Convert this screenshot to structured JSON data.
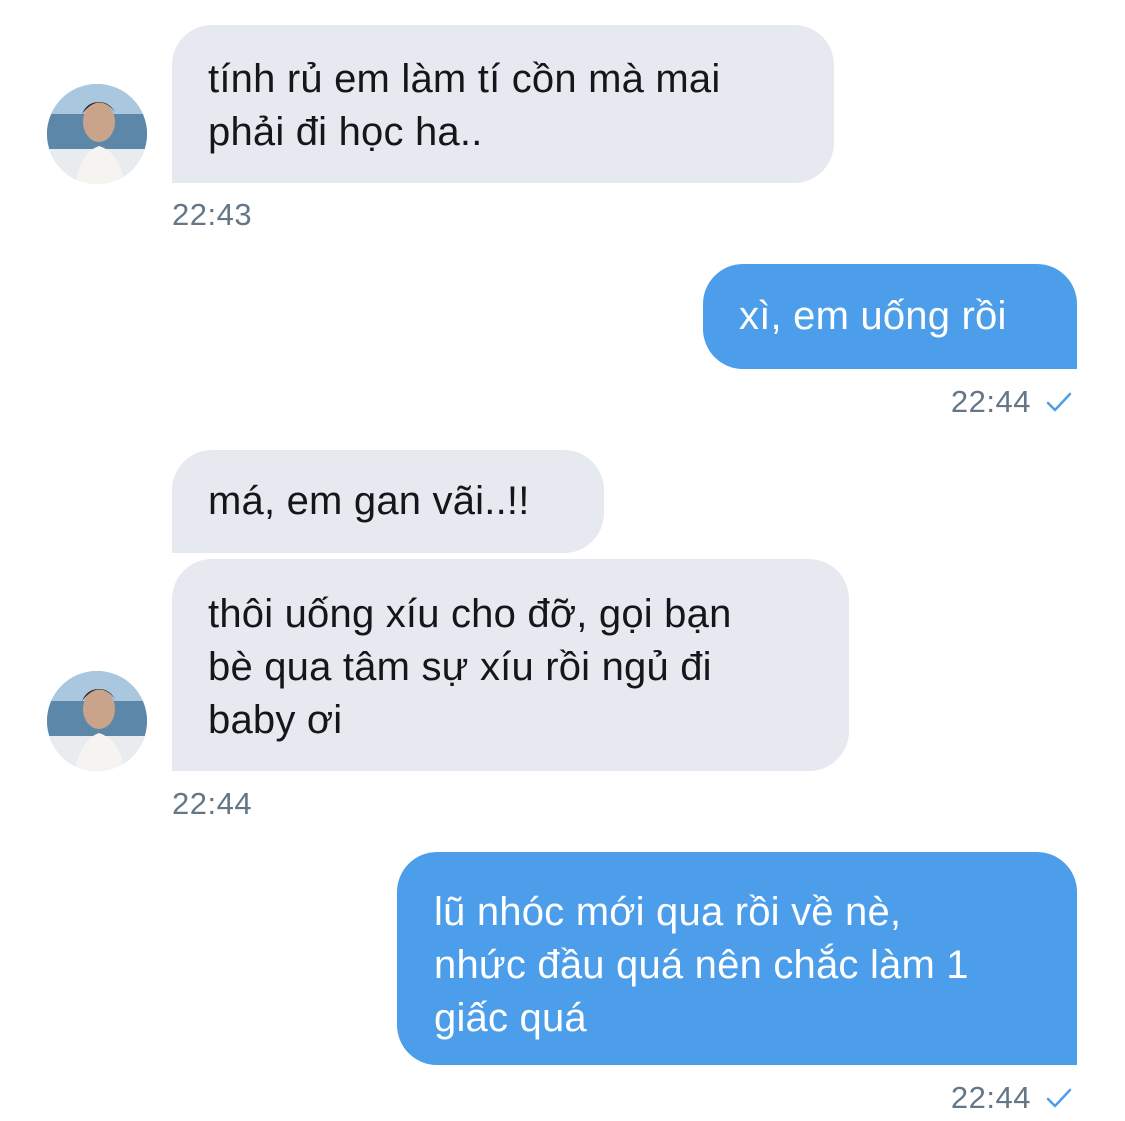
{
  "messages": [
    {
      "sender": "them",
      "text": "tính rủ em làm tí cồn mà mai\nphải đi học ha..",
      "time": "22:43"
    },
    {
      "sender": "me",
      "text": "xì, em uống rồi",
      "time": "22:44",
      "status": "sent-check"
    },
    {
      "sender": "them",
      "text": "má, em gan vãi..!!"
    },
    {
      "sender": "them",
      "text": "thôi uống xíu cho đỡ, gọi bạn\nbè qua tâm sự xíu rồi ngủ đi\nbaby ơi",
      "time": "22:44"
    },
    {
      "sender": "me",
      "text": "lũ nhóc mới qua rồi về nè,\nnhức đầu quá nên chắc làm 1\ngiấc quá",
      "time": "22:44",
      "status": "sent-check"
    }
  ],
  "colors": {
    "incoming_bubble": "#e6e9ef",
    "outgoing_bubble": "#4d9eea",
    "timestamp": "#657786",
    "check": "#4d9eea"
  },
  "icons": {
    "avatar": "contact-avatar-photo",
    "status": "check-icon"
  }
}
